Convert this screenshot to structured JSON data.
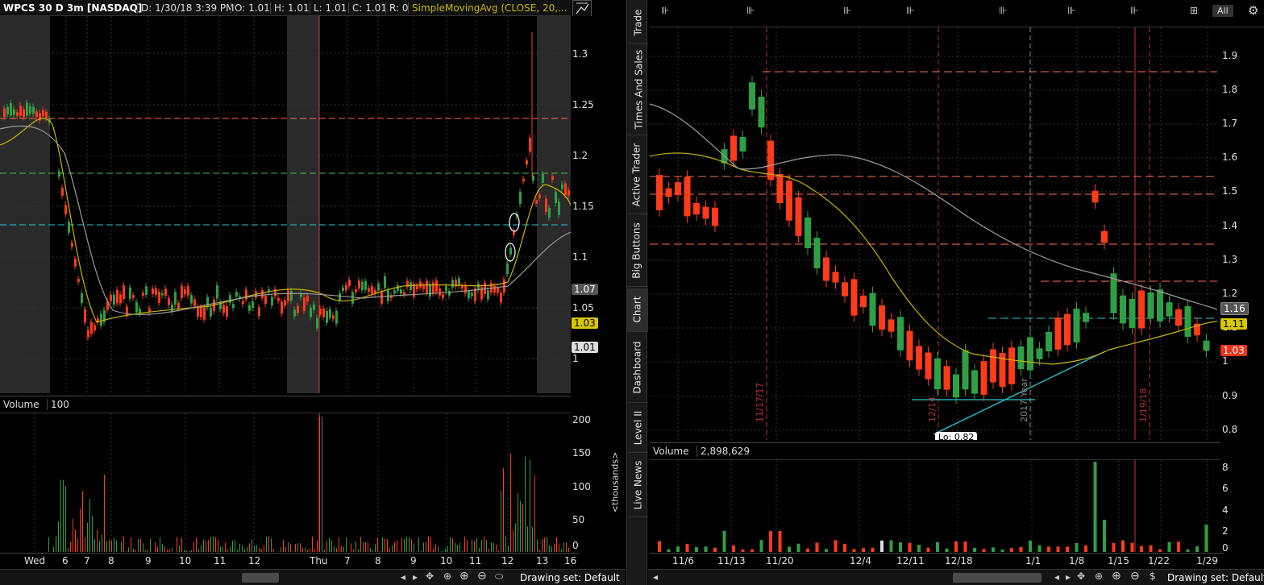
{
  "left_chart": {
    "symbol": "WPCS 30 D 3m [NASDAQ]",
    "date": "D: 1/30/18 3:39 PM",
    "open": "O: 1.01",
    "high": "H: 1.01",
    "low": "L: 1.01",
    "close": "C: 1.01",
    "range": "R: 0",
    "study": "SimpleMovingAvg (CLOSE, 20,...",
    "price_ticks": [
      "1.3",
      "1.25",
      "1.2",
      "1.15",
      "1.1",
      "1.05",
      "1"
    ],
    "price_badges": [
      "1.07",
      "1.03",
      "1.01"
    ],
    "volume_label": "Volume",
    "volume_value": "100",
    "volume_ticks": [
      "200",
      "150",
      "100",
      "50",
      "0"
    ],
    "volume_unit": "<thousands>",
    "time_ticks": [
      "Wed",
      "6",
      "7",
      "8",
      "9",
      "10",
      "11",
      "12",
      "Thu",
      "7",
      "8",
      "9",
      "10",
      "11",
      "12",
      "13",
      "16"
    ],
    "drawing_set": "Drawing set: Default"
  },
  "right_chart": {
    "price_ticks": [
      "1.9",
      "1.8",
      "1.7",
      "1.6",
      "1.5",
      "1.4",
      "1.3",
      "1.2",
      "1.1",
      "1",
      "0.9",
      "0.8"
    ],
    "price_badges": [
      "1.16",
      "1.11",
      "1.03"
    ],
    "vertical_labels": [
      "11/17/17",
      "12/14",
      "2017 Year",
      "1/19/18"
    ],
    "low_callout": "Lo: 0.82",
    "volume_label": "Volume",
    "volume_value": "2,898,629",
    "volume_ticks": [
      "8",
      "6",
      "4",
      "2",
      "0"
    ],
    "time_ticks": [
      "11/6",
      "11/13",
      "11/20",
      "12/4",
      "12/11",
      "12/18",
      "1/1",
      "1/8",
      "1/15",
      "1/22",
      "1/29"
    ],
    "drawing_set": "Drawing set: Default",
    "all_button": "All"
  },
  "side_tabs": [
    "Trade",
    "Times And Sales",
    "Active Trader",
    "Big Buttons",
    "Chart",
    "Dashboard",
    "Level II",
    "Live News"
  ],
  "colors": {
    "up": "#2ea043",
    "down": "#ff3b1a",
    "sma_fast": "#c8b400",
    "sma_slow": "#9a9a9a",
    "cyan": "#28c8d8"
  }
}
